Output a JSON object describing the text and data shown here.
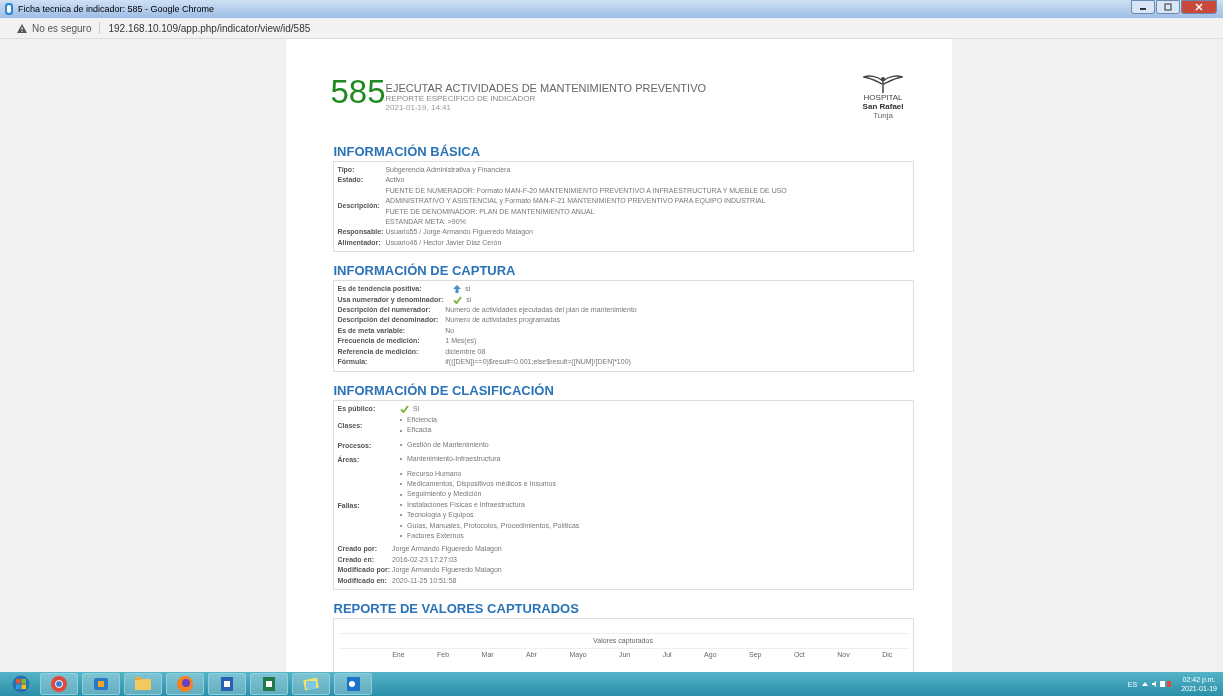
{
  "window": {
    "title": "Ficha tecnica de indicador: 585 - Google Chrome"
  },
  "address_bar": {
    "security": "No es seguro",
    "url": "192.168.10.109/app.php/indicator/view/id/585"
  },
  "header": {
    "number": "585",
    "title": "EJECUTAR ACTIVIDADES DE MANTENIMIENTO PREVENTIVO",
    "subtitle": "REPORTE ESPECIFICO DE INDICADOR",
    "date": "2021-01-19, 14:41",
    "logo_line_1": "HOSPITAL",
    "logo_line_2": "San Rafael",
    "logo_line_3": "Tunja"
  },
  "sections": [
    {
      "title": "INFORMACIÓN BÁSICA",
      "rows": [
        {
          "label": "Tipo:",
          "kind": "text",
          "value": "Subgerencia Administrativa y Financiera"
        },
        {
          "label": "Estado:",
          "kind": "text",
          "value": "Activo"
        },
        {
          "label": "Descripción:",
          "kind": "lines",
          "lines": [
            "FUENTE DE NUMERADOR:  Formato MAN-F-20 MANTENIMIENTO PREVENTIVO A INFRAESTRUCTURA Y MUEBLE DE USO",
            "ADMINISTRATIVO Y ASISTENCIAL y Formato MAN-F-21 MANTENIMIENTO PREVENTIVO PARA EQUIPO INDUSTRIAL",
            "FUETE DE DENOMINADOR:  PLAN DE MANTENIMIENTO ANUAL",
            "ESTANDAR META:  >90%"
          ]
        },
        {
          "label": "Responsable:",
          "kind": "text",
          "value": "Usuario55 / Jorge Armando Figueredo Malagon"
        },
        {
          "label": "Alimentador:",
          "kind": "text",
          "value": "Usuario46 / Hector Javier Diaz Cerón"
        }
      ]
    },
    {
      "title": "INFORMACIÓN DE CAPTURA",
      "rows": [
        {
          "label": "Es de tendencia positiva:",
          "kind": "trend",
          "value": "si"
        },
        {
          "label": "Usa numerador y denominador:",
          "kind": "yes",
          "value": "si"
        },
        {
          "label": "Descripción del numerador:",
          "kind": "text",
          "value": "Numero de actividades ejecutadas del plan de mantenimiento"
        },
        {
          "label": "Descripción del denominador:",
          "kind": "text",
          "value": "Numero de actividades programadas"
        },
        {
          "label": "Es de meta variable:",
          "kind": "text",
          "value": "No"
        },
        {
          "label": "Frecuencia de medición:",
          "kind": "text",
          "value": "1 Mes(es)"
        },
        {
          "label": "Referencia de medición:",
          "kind": "text",
          "value": "diciembre 08"
        },
        {
          "label": "Fórmula:",
          "kind": "text",
          "value": "if(([DEN])==0)$result=0.001;else$result=([NUM]/[DEN]*100)"
        }
      ]
    },
    {
      "title": "INFORMACIÓN DE CLASIFICACIÓN",
      "rows": [
        {
          "label": "Es público:",
          "kind": "yes",
          "value": "Si"
        },
        {
          "label": "Clases:",
          "kind": "list",
          "items": [
            "Eficiencia",
            "Eficacia"
          ]
        },
        {
          "label": "Procesos:",
          "kind": "list",
          "items": [
            "Gestión de Mantenimiento"
          ]
        },
        {
          "label": "Áreas:",
          "kind": "list",
          "items": [
            "Mantenimiento-Infraestructura"
          ]
        },
        {
          "label": "Fallas:",
          "kind": "list",
          "items": [
            "Recurso Humano",
            "Medicamentos, Dispositivos médicos e Insumos",
            "Seguimiento y Medición",
            "Instalaciones Físicas e Infraestructura",
            "Tecnología y Equipos",
            "Guías, Manuales, Protocolos, Procedimientos, Políticas",
            "Factores Externos"
          ]
        },
        {
          "label": "Creado por:",
          "kind": "text",
          "value": "Jorge Armando Figueredo Malagon"
        },
        {
          "label": "Creado en:",
          "kind": "text",
          "value": "2016-02-23 17:27:03"
        },
        {
          "label": "Modificado por:",
          "kind": "text",
          "value": "Jorge Armando Figueredo Malagon"
        },
        {
          "label": "Modificado en:",
          "kind": "text",
          "value": "2020-11-25 10:51:58"
        }
      ]
    }
  ],
  "report": {
    "title": "REPORTE DE VALORES CAPTURADOS",
    "caption": "Valores capturados",
    "columns": [
      "Ene",
      "Feb",
      "Mar",
      "Abr",
      "Mayo",
      "Jun",
      "Jul",
      "Ago",
      "Sep",
      "Oct",
      "Nov",
      "Dic"
    ]
  },
  "taskbar": {
    "language": "ES",
    "time": "02:42 p.m.",
    "date": "2021-01-19"
  }
}
